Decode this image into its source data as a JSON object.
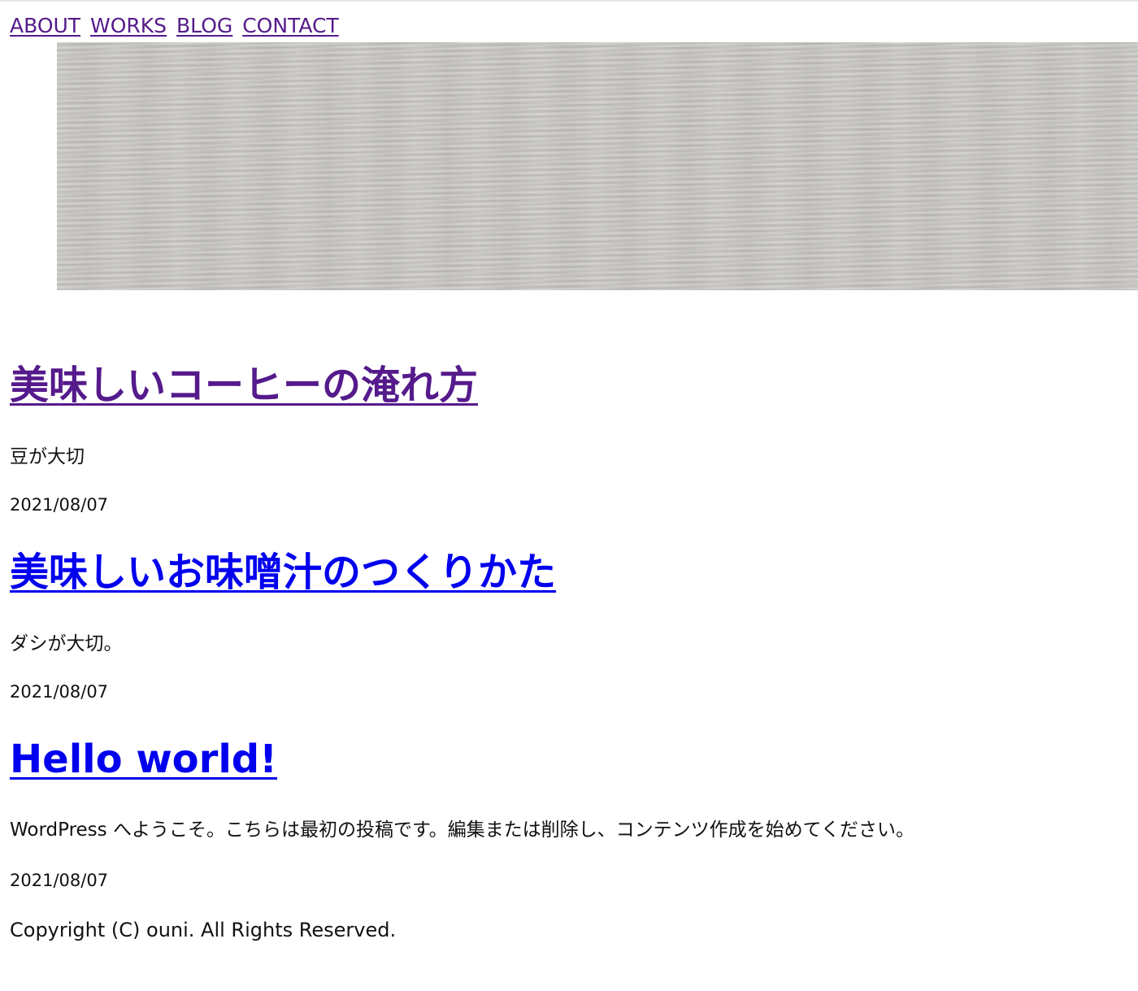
{
  "nav": {
    "items": [
      {
        "label": "ABOUT"
      },
      {
        "label": "WORKS"
      },
      {
        "label": "BLOG"
      },
      {
        "label": "CONTACT"
      }
    ]
  },
  "posts": [
    {
      "title": "美味しいコーヒーの淹れ方",
      "excerpt": "豆が大切",
      "date": "2021/08/07"
    },
    {
      "title": "美味しいお味噌汁のつくりかた",
      "excerpt": "ダシが大切。",
      "date": "2021/08/07"
    },
    {
      "title": "Hello world!",
      "excerpt": "WordPress へようこそ。こちらは最初の投稿です。編集または削除し、コンテンツ作成を始めてください。",
      "date": "2021/08/07"
    }
  ],
  "footer": {
    "copyright": "Copyright (C) ouni. All Rights Reserved."
  },
  "colors": {
    "visited_link": "#551a8b",
    "unvisited_link": "#0000ee",
    "hero_background": "#cbc9c6"
  }
}
